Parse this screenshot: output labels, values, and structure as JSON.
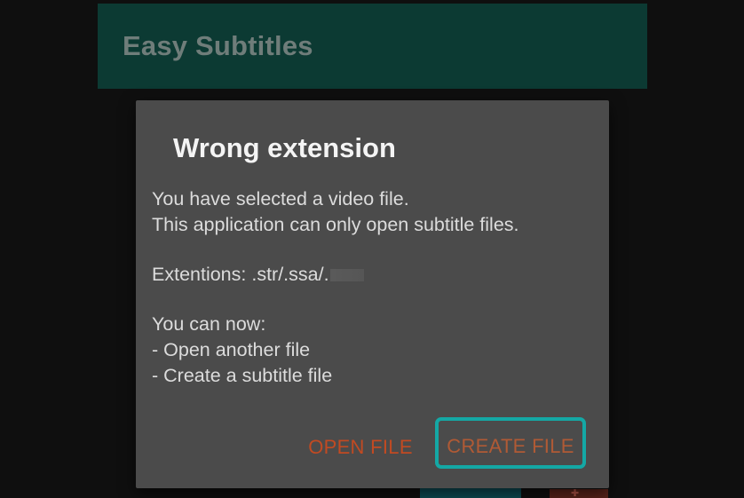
{
  "app_bar": {
    "title": "Easy Subtitles"
  },
  "dialog": {
    "title": "Wrong extension",
    "message_lines": [
      "You have selected a video file.",
      "This application can only open subtitle files."
    ],
    "extensions_text": "Extentions: .str/.ssa/.",
    "options_intro": "You can now:",
    "options": [
      "- Open another file",
      "- Create a subtitle file"
    ],
    "buttons": {
      "open_file": "OPEN FILE",
      "create_file": "CREATE FILE"
    }
  },
  "colors": {
    "app_bar_bg": "#0c3a33",
    "dialog_bg": "#4b4b4b",
    "button_text": "#c14a22",
    "focus_ring": "#14a8a5"
  }
}
